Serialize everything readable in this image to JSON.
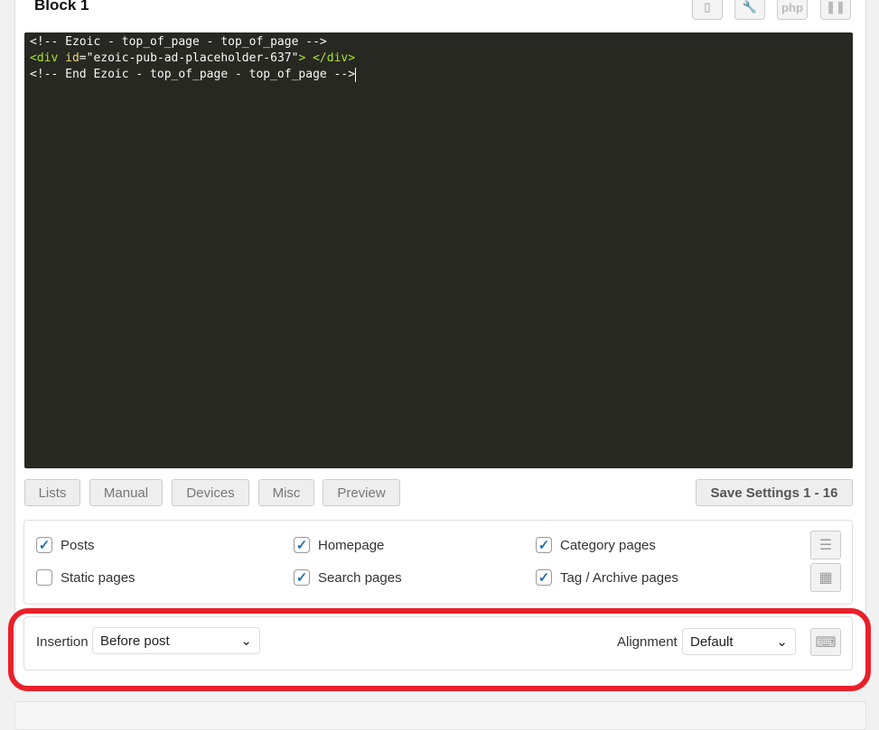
{
  "block": {
    "title": "Block 1",
    "icons": [
      "device-icon",
      "wrench-icon",
      "php-icon",
      "pause-icon"
    ],
    "php_label": "php"
  },
  "editor": {
    "line1": "<!-- Ezoic - top_of_page - top_of_page -->",
    "line2_open": "<div",
    "line2_attr": "id",
    "line2_eq": "=",
    "line2_val": "\"ezoic-pub-ad-placeholder-637\"",
    "line2_close": "> </div>",
    "line3": "<!-- End Ezoic - top_of_page - top_of_page -->"
  },
  "tabs": [
    "Lists",
    "Manual",
    "Devices",
    "Misc",
    "Preview"
  ],
  "save_label": "Save Settings 1 - 16",
  "checkboxes": [
    {
      "label": "Posts",
      "checked": true
    },
    {
      "label": "Homepage",
      "checked": true
    },
    {
      "label": "Category pages",
      "checked": true
    },
    {
      "label": "Static pages",
      "checked": false
    },
    {
      "label": "Search pages",
      "checked": true
    },
    {
      "label": "Tag / Archive pages",
      "checked": true
    }
  ],
  "insertion": {
    "label": "Insertion",
    "value": "Before post"
  },
  "alignment": {
    "label": "Alignment",
    "value": "Default"
  },
  "colors": {
    "highlight": "#e8202a",
    "editor_bg": "#272822",
    "check": "#2271b1"
  }
}
